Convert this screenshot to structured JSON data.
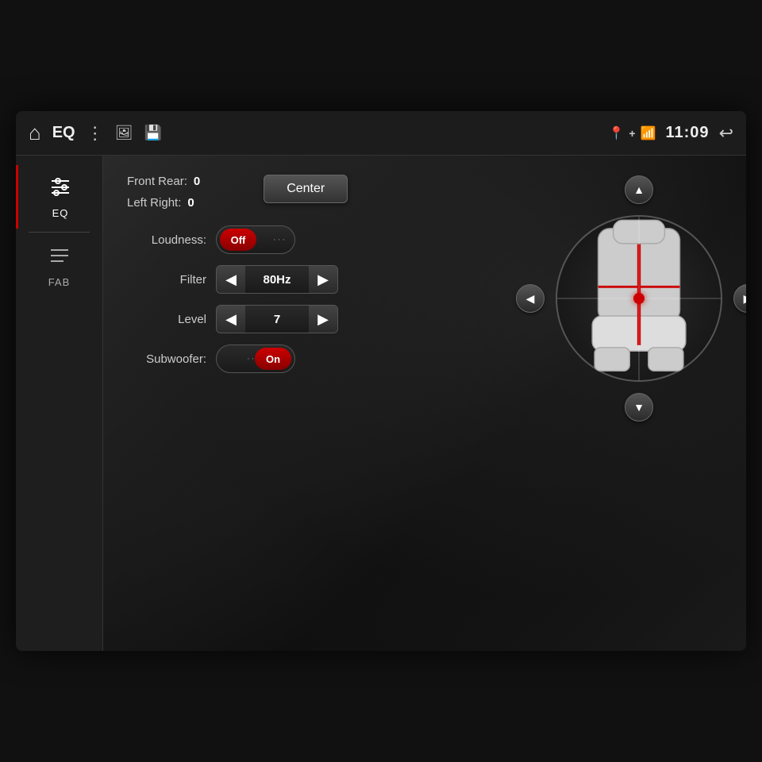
{
  "header": {
    "home_icon": "⌂",
    "eq_label": "EQ",
    "menu_icon": "⋮",
    "gallery_icon": "🖼",
    "sd_icon": "💾",
    "gps_icon": "📍",
    "bt_icon": "🅱",
    "wifi_icon": "📶",
    "time": "11:09",
    "back_icon": "↩"
  },
  "sidebar": {
    "items": [
      {
        "id": "eq",
        "label": "EQ",
        "icon": "⊞",
        "active": true
      },
      {
        "id": "fab",
        "label": "FAB",
        "icon": "≡",
        "active": false
      }
    ]
  },
  "balance": {
    "front_rear_label": "Front Rear:",
    "front_rear_value": "0",
    "left_right_label": "Left Right:",
    "left_right_value": "0",
    "center_label": "Center"
  },
  "arrows": {
    "up": "▲",
    "down": "▼",
    "left": "◀",
    "right": "▶"
  },
  "loudness": {
    "label": "Loudness:",
    "state": "off",
    "off_text": "Off"
  },
  "filter": {
    "label": "Filter",
    "value": "80Hz"
  },
  "level": {
    "label": "Level",
    "value": "7"
  },
  "subwoofer": {
    "label": "Subwoofer:",
    "state": "on",
    "on_text": "On"
  }
}
